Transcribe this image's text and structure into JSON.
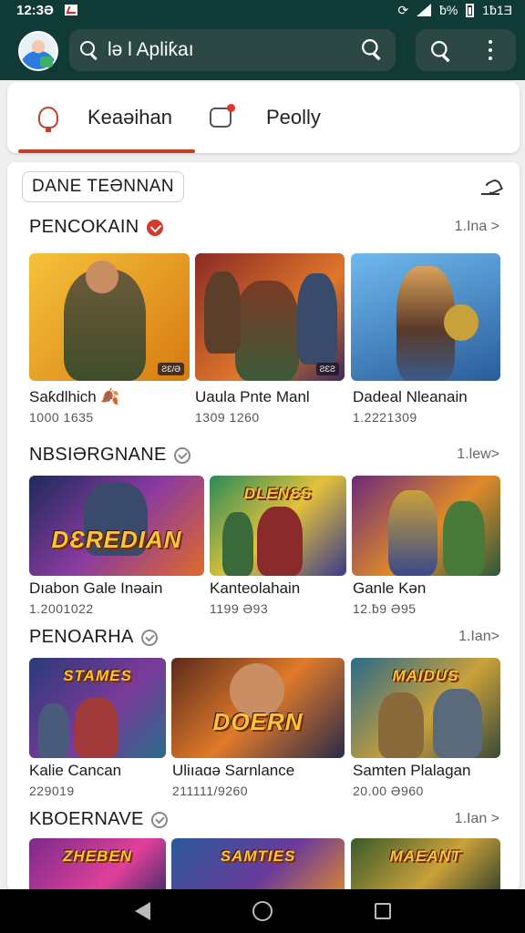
{
  "status": {
    "time": "12:3Ə",
    "battery_text": "ƀ% ",
    "right_text": "1ƀ1Ǝ"
  },
  "search": {
    "text": "lə l Apliƙaı"
  },
  "tabs": [
    {
      "label": "Keaəihan",
      "active": true
    },
    {
      "label": "Peolly",
      "active": false
    }
  ],
  "filter_chip": "DANE TEƏNNAN",
  "sections": [
    {
      "title": "PENCOKAIN",
      "badge": "red",
      "more": "1.Ina >",
      "games": [
        {
          "title": "Saƙdlhich 🍂",
          "sub": "1000 1635",
          "tag": "ƧƐ/Ə"
        },
        {
          "title": "Uaula Pnte Manl",
          "sub": "1309 1260",
          "tag": "ƧƐƧ"
        },
        {
          "title": "Dadeal Nleanain",
          "sub": "1.2221309",
          "tag": ""
        }
      ]
    },
    {
      "title": "NBSIƏRGNANE",
      "badge": "grey",
      "more": "1.lew>",
      "games": [
        {
          "title": "Dıabon Gale Inəain",
          "sub": "1.2001022",
          "tag": "",
          "logo": "DƐREDIAN"
        },
        {
          "title": "Kanteolahain",
          "sub": "1199 Ə93",
          "tag": "",
          "logo": "DLENƐS"
        },
        {
          "title": "Ganle Kən",
          "sub": "12.ƀ9 Ə95",
          "tag": ""
        }
      ]
    },
    {
      "title": "PENOARHA",
      "badge": "grey",
      "more": "1.Ian>",
      "games": [
        {
          "title": "Kalie Cancan",
          "sub": "229019",
          "tag": "",
          "logo": "STAMES"
        },
        {
          "title": "Uliıaɑə Sarnlance",
          "sub": "211111/9260",
          "tag": "",
          "logo": "DOERN"
        },
        {
          "title": "Samten Plalagan",
          "sub": "20.00 Ə960",
          "tag": "",
          "logo": "MAIDUS"
        }
      ]
    },
    {
      "title": "KBOERNAVE",
      "badge": "grey",
      "more": "1.Ian >",
      "games": [
        {
          "title": "",
          "sub": "",
          "tag": "",
          "logo": "ZHEBEN"
        },
        {
          "title": "",
          "sub": "",
          "tag": "",
          "logo": "SAMTIES"
        },
        {
          "title": "",
          "sub": "",
          "tag": "",
          "logo": "MAEANT"
        }
      ]
    }
  ],
  "icons": [
    "avatar",
    "search-icon",
    "more-vert-icon",
    "alert-icon",
    "chat-icon",
    "edit-icon",
    "back-icon",
    "home-icon",
    "recents-icon"
  ],
  "colors": {
    "appbar": "#0f3a35",
    "accent": "#c43f2a",
    "badge_red": "#d5392b"
  }
}
